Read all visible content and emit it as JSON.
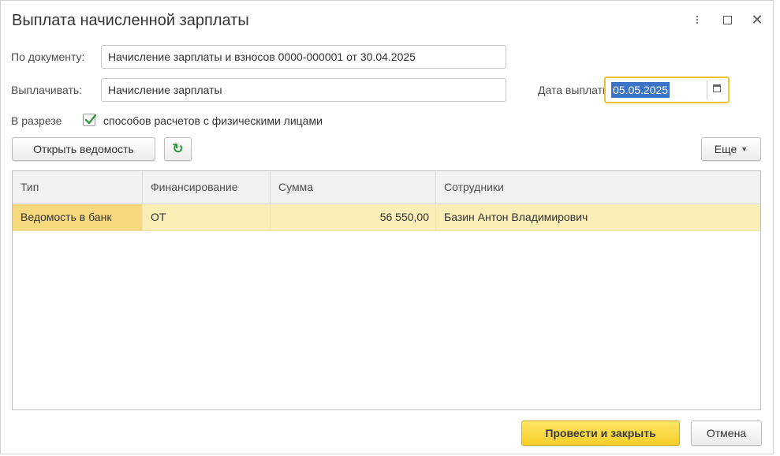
{
  "window": {
    "title": "Выплата начисленной зарплаты",
    "controls": [
      "more-icon",
      "maximize-icon",
      "close-icon"
    ]
  },
  "form": {
    "document_label": "По документу:",
    "document_value": "Начисление зарплаты и взносов 0000-000001 от 30.04.2025",
    "pay_label": "Выплачивать:",
    "pay_value": "Начисление зарплаты",
    "date_label": "Дата выплаты:",
    "date_value": "05.05.2025",
    "breakdown_label": "В разрезе",
    "breakdown_checked": true,
    "breakdown_option": "способов расчетов с физическими лицами"
  },
  "toolbar": {
    "open_statement": "Открыть ведомость",
    "more": "Еще"
  },
  "table": {
    "columns": [
      "Тип",
      "Финансирование",
      "Сумма",
      "Сотрудники"
    ],
    "rows": [
      [
        "Ведомость в банк",
        "ОТ",
        "56 550,00",
        "Базин Антон Владимирович"
      ]
    ]
  },
  "footer": {
    "post_close": "Провести и закрыть",
    "cancel": "Отмена"
  },
  "colors": {
    "accent_yellow": "#f7cf2a",
    "selected_row": "#fbeeb7",
    "check_green": "#2e9a3c",
    "selection_blue": "#3b73c7"
  }
}
